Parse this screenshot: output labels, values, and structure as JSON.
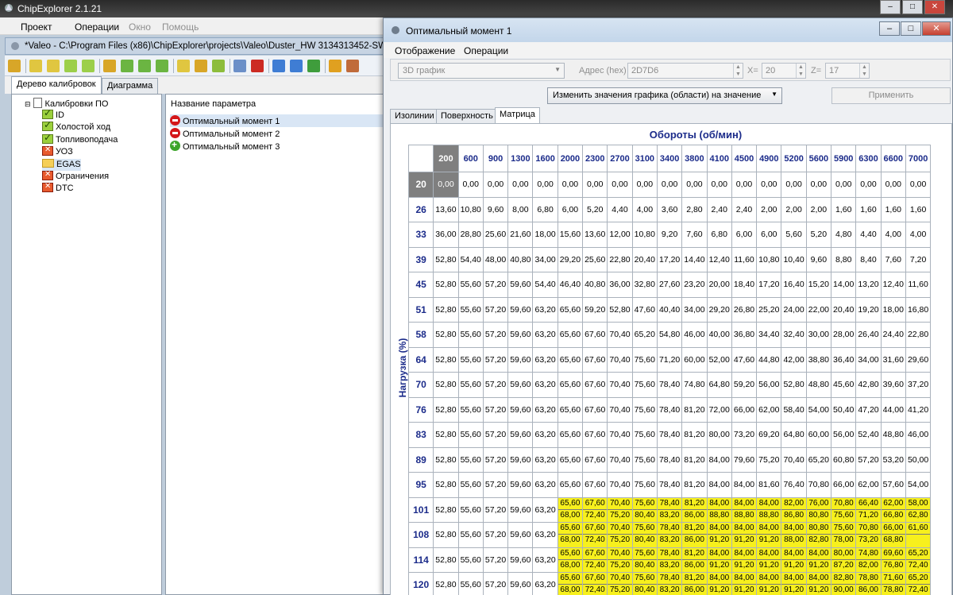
{
  "app": {
    "title": "ChipExplorer 2.1.21",
    "menu": [
      {
        "label": "Проект",
        "disabled": false
      },
      {
        "label": "Операции",
        "disabled": false
      },
      {
        "label": "Окно",
        "disabled": true
      },
      {
        "label": "Помощь",
        "disabled": true
      }
    ]
  },
  "child": {
    "title": "*Valeo - C:\\Program Files (x86)\\ChipExplorer\\projects\\Valeo\\Duster_HW 3134313452-SW",
    "tabs": [
      "Дерево калибровок",
      "Диаграмма"
    ],
    "tree": {
      "root": "Калибровки ПО",
      "items": [
        {
          "label": "ID",
          "icon": "check-icon"
        },
        {
          "label": "Холостой ход",
          "icon": "check-icon"
        },
        {
          "label": "Топливоподача",
          "icon": "check-icon"
        },
        {
          "label": "УОЗ",
          "icon": "x-icon"
        },
        {
          "label": "EGAS",
          "icon": "folder-icon"
        },
        {
          "label": "Ограничения",
          "icon": "x-icon"
        },
        {
          "label": "DTC",
          "icon": "x-icon"
        }
      ]
    },
    "params": {
      "header": "Название параметра",
      "items": [
        {
          "label": "Оптимальный момент 1",
          "icon": "red-minus-icon"
        },
        {
          "label": "Оптимальный момент 2",
          "icon": "red-minus-icon"
        },
        {
          "label": "Оптимальный момент 3",
          "icon": "green-plus-icon"
        }
      ]
    }
  },
  "dialog": {
    "title": "Оптимальный момент 1",
    "menu": [
      "Отображение",
      "Операции"
    ],
    "view_combo": "3D график",
    "address_label": "Адрес (hex)",
    "address": "2D7D6",
    "x_label": "X=",
    "x_value": "20",
    "z_label": "Z=",
    "z_value": "17",
    "action_combo": "Изменить значения графика (области) на значение",
    "apply_label": "Применить",
    "tabs": [
      "Изолинии",
      "Поверхность",
      "Матрица"
    ],
    "x_axis_title": "Обороты (об/мин)",
    "y_axis_title": "Нагрузка (%)",
    "columns": [
      "200",
      "600",
      "900",
      "1300",
      "1600",
      "2000",
      "2300",
      "2700",
      "3100",
      "3400",
      "3800",
      "4100",
      "4500",
      "4900",
      "5200",
      "5600",
      "5900",
      "6300",
      "6600",
      "7000"
    ],
    "rows": [
      {
        "label": "20",
        "values": [
          "0,00",
          "0,00",
          "0,00",
          "0,00",
          "0,00",
          "0,00",
          "0,00",
          "0,00",
          "0,00",
          "0,00",
          "0,00",
          "0,00",
          "0,00",
          "0,00",
          "0,00",
          "0,00",
          "0,00",
          "0,00",
          "0,00",
          "0,00"
        ]
      },
      {
        "label": "26",
        "values": [
          "13,60",
          "10,80",
          "9,60",
          "8,00",
          "6,80",
          "6,00",
          "5,20",
          "4,40",
          "4,00",
          "3,60",
          "2,80",
          "2,40",
          "2,40",
          "2,00",
          "2,00",
          "2,00",
          "1,60",
          "1,60",
          "1,60",
          "1,60"
        ]
      },
      {
        "label": "33",
        "values": [
          "36,00",
          "28,80",
          "25,60",
          "21,60",
          "18,00",
          "15,60",
          "13,60",
          "12,00",
          "10,80",
          "9,20",
          "7,60",
          "6,80",
          "6,00",
          "6,00",
          "5,60",
          "5,20",
          "4,80",
          "4,40",
          "4,00",
          "4,00"
        ]
      },
      {
        "label": "39",
        "values": [
          "52,80",
          "54,40",
          "48,00",
          "40,80",
          "34,00",
          "29,20",
          "25,60",
          "22,80",
          "20,40",
          "17,20",
          "14,40",
          "12,40",
          "11,60",
          "10,80",
          "10,40",
          "9,60",
          "8,80",
          "8,40",
          "7,60",
          "7,20"
        ]
      },
      {
        "label": "45",
        "values": [
          "52,80",
          "55,60",
          "57,20",
          "59,60",
          "54,40",
          "46,40",
          "40,80",
          "36,00",
          "32,80",
          "27,60",
          "23,20",
          "20,00",
          "18,40",
          "17,20",
          "16,40",
          "15,20",
          "14,00",
          "13,20",
          "12,40",
          "11,60"
        ]
      },
      {
        "label": "51",
        "values": [
          "52,80",
          "55,60",
          "57,20",
          "59,60",
          "63,20",
          "65,60",
          "59,20",
          "52,80",
          "47,60",
          "40,40",
          "34,00",
          "29,20",
          "26,80",
          "25,20",
          "24,00",
          "22,00",
          "20,40",
          "19,20",
          "18,00",
          "16,80"
        ]
      },
      {
        "label": "58",
        "values": [
          "52,80",
          "55,60",
          "57,20",
          "59,60",
          "63,20",
          "65,60",
          "67,60",
          "70,40",
          "65,20",
          "54,80",
          "46,00",
          "40,00",
          "36,80",
          "34,40",
          "32,40",
          "30,00",
          "28,00",
          "26,40",
          "24,40",
          "22,80"
        ]
      },
      {
        "label": "64",
        "values": [
          "52,80",
          "55,60",
          "57,20",
          "59,60",
          "63,20",
          "65,60",
          "67,60",
          "70,40",
          "75,60",
          "71,20",
          "60,00",
          "52,00",
          "47,60",
          "44,80",
          "42,00",
          "38,80",
          "36,40",
          "34,00",
          "31,60",
          "29,60"
        ]
      },
      {
        "label": "70",
        "values": [
          "52,80",
          "55,60",
          "57,20",
          "59,60",
          "63,20",
          "65,60",
          "67,60",
          "70,40",
          "75,60",
          "78,40",
          "74,80",
          "64,80",
          "59,20",
          "56,00",
          "52,80",
          "48,80",
          "45,60",
          "42,80",
          "39,60",
          "37,20"
        ]
      },
      {
        "label": "76",
        "values": [
          "52,80",
          "55,60",
          "57,20",
          "59,60",
          "63,20",
          "65,60",
          "67,60",
          "70,40",
          "75,60",
          "78,40",
          "81,20",
          "72,00",
          "66,00",
          "62,00",
          "58,40",
          "54,00",
          "50,40",
          "47,20",
          "44,00",
          "41,20"
        ]
      },
      {
        "label": "83",
        "values": [
          "52,80",
          "55,60",
          "57,20",
          "59,60",
          "63,20",
          "65,60",
          "67,60",
          "70,40",
          "75,60",
          "78,40",
          "81,20",
          "80,00",
          "73,20",
          "69,20",
          "64,80",
          "60,00",
          "56,00",
          "52,40",
          "48,80",
          "46,00"
        ]
      },
      {
        "label": "89",
        "values": [
          "52,80",
          "55,60",
          "57,20",
          "59,60",
          "63,20",
          "65,60",
          "67,60",
          "70,40",
          "75,60",
          "78,40",
          "81,20",
          "84,00",
          "79,60",
          "75,20",
          "70,40",
          "65,20",
          "60,80",
          "57,20",
          "53,20",
          "50,00"
        ]
      },
      {
        "label": "95",
        "values": [
          "52,80",
          "55,60",
          "57,20",
          "59,60",
          "63,20",
          "65,60",
          "67,60",
          "70,40",
          "75,60",
          "78,40",
          "81,20",
          "84,00",
          "84,00",
          "81,60",
          "76,40",
          "70,80",
          "66,00",
          "62,00",
          "57,60",
          "54,00"
        ]
      },
      {
        "label": "101",
        "values": [
          "52,80",
          "55,60",
          "57,20",
          "59,60",
          "63,20"
        ],
        "dual_top": [
          "65,60",
          "67,60",
          "70,40",
          "75,60",
          "78,40",
          "81,20",
          "84,00",
          "84,00",
          "84,00",
          "82,00",
          "76,00",
          "70,80",
          "66,40",
          "62,00",
          "58,00"
        ],
        "dual_bottom": [
          "68,00",
          "72,40",
          "75,20",
          "80,40",
          "83,20",
          "86,00",
          "88,80",
          "88,80",
          "88,80",
          "86,80",
          "80,80",
          "75,60",
          "71,20",
          "66,80",
          "62,80"
        ]
      },
      {
        "label": "108",
        "values": [
          "52,80",
          "55,60",
          "57,20",
          "59,60",
          "63,20"
        ],
        "dual_top": [
          "65,60",
          "67,60",
          "70,40",
          "75,60",
          "78,40",
          "81,20",
          "84,00",
          "84,00",
          "84,00",
          "84,00",
          "80,80",
          "75,60",
          "70,80",
          "66,00",
          "61,60"
        ],
        "dual_bottom": [
          "68,00",
          "72,40",
          "75,20",
          "80,40",
          "83,20",
          "86,00",
          "91,20",
          "91,20",
          "91,20",
          "88,00",
          "82,80",
          "78,00",
          "73,20",
          "68,80"
        ]
      },
      {
        "label": "114",
        "values": [
          "52,80",
          "55,60",
          "57,20",
          "59,60",
          "63,20"
        ],
        "dual_top": [
          "65,60",
          "67,60",
          "70,40",
          "75,60",
          "78,40",
          "81,20",
          "84,00",
          "84,00",
          "84,00",
          "84,00",
          "84,00",
          "80,00",
          "74,80",
          "69,60",
          "65,20"
        ],
        "dual_bottom": [
          "68,00",
          "72,40",
          "75,20",
          "80,40",
          "83,20",
          "86,00",
          "91,20",
          "91,20",
          "91,20",
          "91,20",
          "91,20",
          "87,20",
          "82,00",
          "76,80",
          "72,40"
        ]
      },
      {
        "label": "120",
        "values": [
          "52,80",
          "55,60",
          "57,20",
          "59,60",
          "63,20"
        ],
        "dual_top": [
          "65,60",
          "67,60",
          "70,40",
          "75,60",
          "78,40",
          "81,20",
          "84,00",
          "84,00",
          "84,00",
          "84,00",
          "84,00",
          "82,80",
          "78,80",
          "71,60",
          "65,20"
        ],
        "dual_bottom": [
          "68,00",
          "72,40",
          "75,20",
          "80,40",
          "83,20",
          "86,00",
          "91,20",
          "91,20",
          "91,20",
          "91,20",
          "91,20",
          "90,00",
          "86,00",
          "78,80",
          "72,40"
        ]
      }
    ],
    "colors": {
      "highlight": "#f7f01d",
      "axis_text": "#1b2b8a",
      "selected": "#7f7f7f"
    }
  }
}
